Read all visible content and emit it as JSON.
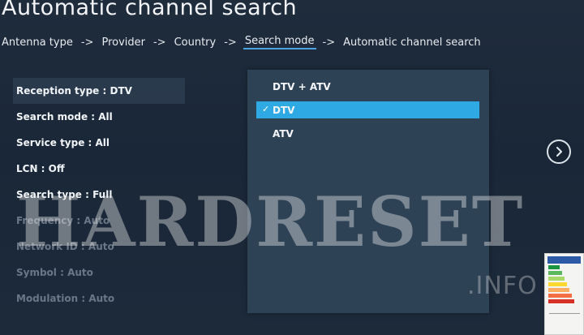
{
  "header": {
    "title": "Automatic channel search"
  },
  "breadcrumb": {
    "items": [
      "Antenna type",
      "Provider",
      "Country",
      "Search mode",
      "Automatic channel search"
    ],
    "separator": "->",
    "active_index": 3
  },
  "settings": {
    "items": [
      {
        "label": "Reception type : DTV",
        "selected": true,
        "dim": false
      },
      {
        "label": "Search mode : All",
        "selected": false,
        "dim": false
      },
      {
        "label": "Service type : All",
        "selected": false,
        "dim": false
      },
      {
        "label": "LCN : Off",
        "selected": false,
        "dim": false
      },
      {
        "label": "Search type : Full",
        "selected": false,
        "dim": false
      },
      {
        "label": "Frequency : Auto",
        "selected": false,
        "dim": true
      },
      {
        "label": "Network ID : Auto",
        "selected": false,
        "dim": true
      },
      {
        "label": "Symbol : Auto",
        "selected": false,
        "dim": true
      },
      {
        "label": "Modulation : Auto",
        "selected": false,
        "dim": true
      }
    ]
  },
  "dropdown": {
    "options": [
      {
        "label": "DTV + ATV",
        "checked": false,
        "highlighted": false
      },
      {
        "label": "DTV",
        "checked": true,
        "highlighted": true
      },
      {
        "label": "ATV",
        "checked": false,
        "highlighted": false
      }
    ],
    "check_glyph": "✓"
  },
  "navigation": {
    "next_icon": "chevron-right-circle-icon"
  },
  "watermark": {
    "main": "HARDRESET",
    "sub": ".INFO"
  },
  "colors": {
    "background": "#1c2a3a",
    "dropdown_bg": "#2e4256",
    "highlight": "#2fa9e3",
    "active_underline": "#4aa3df",
    "dim_text": "#6b7786"
  }
}
